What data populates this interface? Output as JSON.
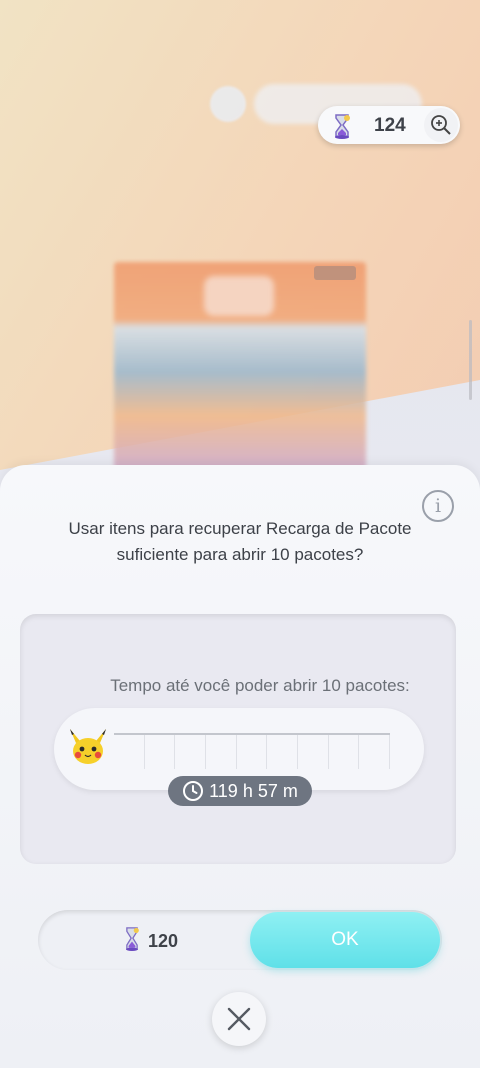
{
  "currency": {
    "hourglass_count": "124",
    "hourglass_icon": "pack-hourglass-icon",
    "zoom_icon": "zoom-in-icon"
  },
  "dialog": {
    "question": "Usar itens para recuperar Recarga de Pacote suficiente para abrir 10 pacotes?",
    "info_icon": "info-icon",
    "info_glyph": "i",
    "timer_label": "Tempo até você poder abrir 10 pacotes:",
    "timer_value": "119 h 57 m",
    "progress_fraction": 0,
    "segment_count": 9,
    "cost_value": "120",
    "ok_label": "OK",
    "close_icon": "close-icon"
  },
  "colors": {
    "ok_button": "#5fe0e8",
    "timer_badge": "#6e7581"
  }
}
